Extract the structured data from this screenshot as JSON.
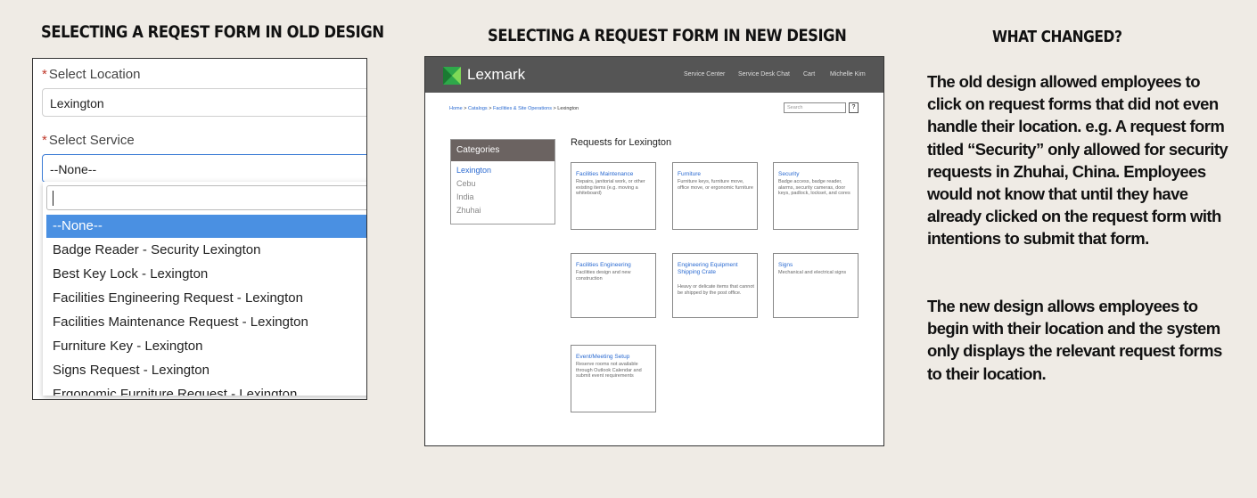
{
  "headings": {
    "old": "SELECTING A REQEST FORM IN OLD DESIGN",
    "new": "SELECTING A REQUEST FORM IN NEW DESIGN",
    "changed": "WHAT CHANGED?"
  },
  "old_design": {
    "location_label": "Select Location",
    "location_value": "Lexington",
    "service_label": "Select Service",
    "service_value": "--None--",
    "required_mark": "*",
    "options": [
      "--None--",
      "Badge Reader - Security Lexington",
      "Best Key Lock - Lexington",
      "Facilities Engineering Request - Lexington",
      "Facilities Maintenance Request - Lexington",
      "Furniture Key - Lexington",
      "Signs Request - Lexington",
      "Ergonomic Furniture Request - Lexington"
    ]
  },
  "new_design": {
    "brand": "Lexmark",
    "brand_color": "#2ea84a",
    "topnav": [
      "Service Center",
      "Service Desk Chat",
      "Cart",
      "Michelle Kim"
    ],
    "breadcrumbs": [
      "Home",
      ">",
      "Catalogs",
      ">",
      "Facilities & Site Operations",
      ">",
      "Lexington"
    ],
    "search_placeholder": "Search",
    "search_button": "?",
    "categories_title": "Categories",
    "categories": [
      "Lexington",
      "Cebu",
      "India",
      "Zhuhai"
    ],
    "requests_title": "Requests for Lexington",
    "cards": [
      {
        "title": "Facilities Maintenance",
        "desc": "Repairs, janitorial work, or other existing items (e.g. moving a whiteboard)"
      },
      {
        "title": "Furniture",
        "desc": "Furniture keys, furniture move, office move, or ergonomic furniture"
      },
      {
        "title": "Security",
        "desc": "Badge access, badge reader, alarms, security cameras, door keys, padlock, lockset, and cores"
      },
      {
        "title": "Facilities Engineering",
        "desc": "Facilities design and new construction"
      },
      {
        "title": "Engineering Equipment Shipping Crate",
        "desc": "Heavy or delicate items that cannot be shipped by the post office."
      },
      {
        "title": "Signs",
        "desc": "Mechanical and electrical signs"
      },
      {
        "title": "Event/Meeting Setup",
        "desc": "Reserve rooms not available through Outlook Calendar and submit event requirements"
      }
    ]
  },
  "what_changed": {
    "p1": "The old design allowed employees to click on request forms that did not even handle their location. e.g. A request form titled “Security” only allowed for security requests in Zhuhai, China. Employees would not know that until they have already clicked on the request form with intentions to submit that form.",
    "p2": "The new design allows employees to begin with their location and the system only displays the relevant request forms to their location."
  }
}
